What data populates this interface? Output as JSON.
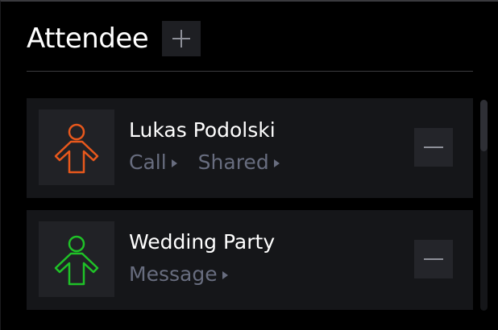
{
  "header": {
    "title": "Attendee",
    "add_button_icon": "plus-icon"
  },
  "attendees": [
    {
      "name": "Lukas Podolski",
      "avatar_icon": "person-icon",
      "avatar_color": "#e8581c",
      "actions": [
        "Call",
        "Shared"
      ],
      "remove_icon": "minus-icon"
    },
    {
      "name": "Wedding Party",
      "avatar_icon": "person-icon",
      "avatar_color": "#1fc227",
      "actions": [
        "Message"
      ],
      "remove_icon": "minus-icon"
    }
  ],
  "colors": {
    "background": "#000000",
    "card": "#151619",
    "muted_text": "#686d7f"
  }
}
